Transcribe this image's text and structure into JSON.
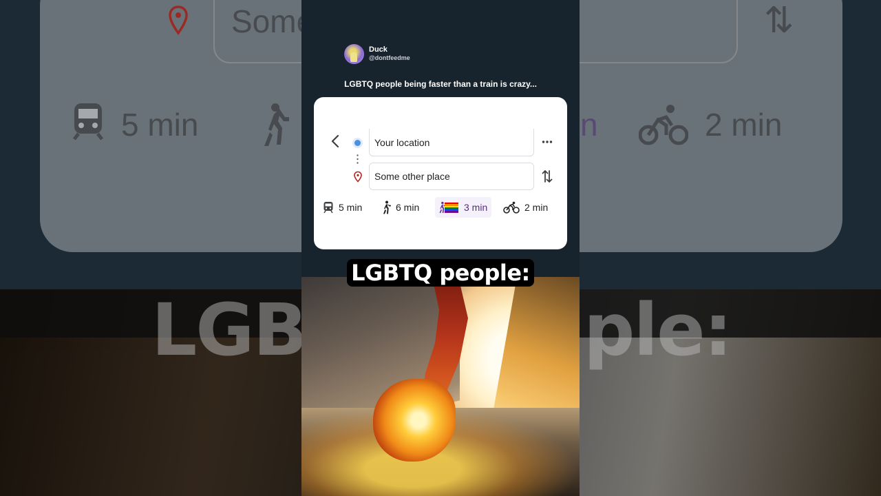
{
  "background": {
    "location_text": "Some",
    "train_time": "5 min",
    "bike_time": "2 min",
    "lgbtq_partial": "n",
    "caption_left": "LGB",
    "caption_right": "ple:"
  },
  "tweet": {
    "author_name": "Duck",
    "author_handle": "@dontfeedme",
    "text": "LGBTQ people being faster than a train is crazy..."
  },
  "directions": {
    "origin": "Your location",
    "destination": "Some other place",
    "modes": [
      {
        "icon": "train-icon",
        "label": "5 min"
      },
      {
        "icon": "walk-icon",
        "label": "6 min"
      },
      {
        "icon": "pride-walk-icon",
        "label": "3 min"
      },
      {
        "icon": "bike-icon",
        "label": "2 min"
      }
    ]
  },
  "caption": "LGBTQ people:",
  "colors": {
    "phone_bg": "#17232d",
    "accent_blue": "#4a8fe0",
    "pin_red": "#b3261e",
    "pride_purple": "#5b2a86",
    "pride_flag": [
      "#e40303",
      "#ff8c00",
      "#ffed00",
      "#008026",
      "#004dff",
      "#750787"
    ]
  }
}
